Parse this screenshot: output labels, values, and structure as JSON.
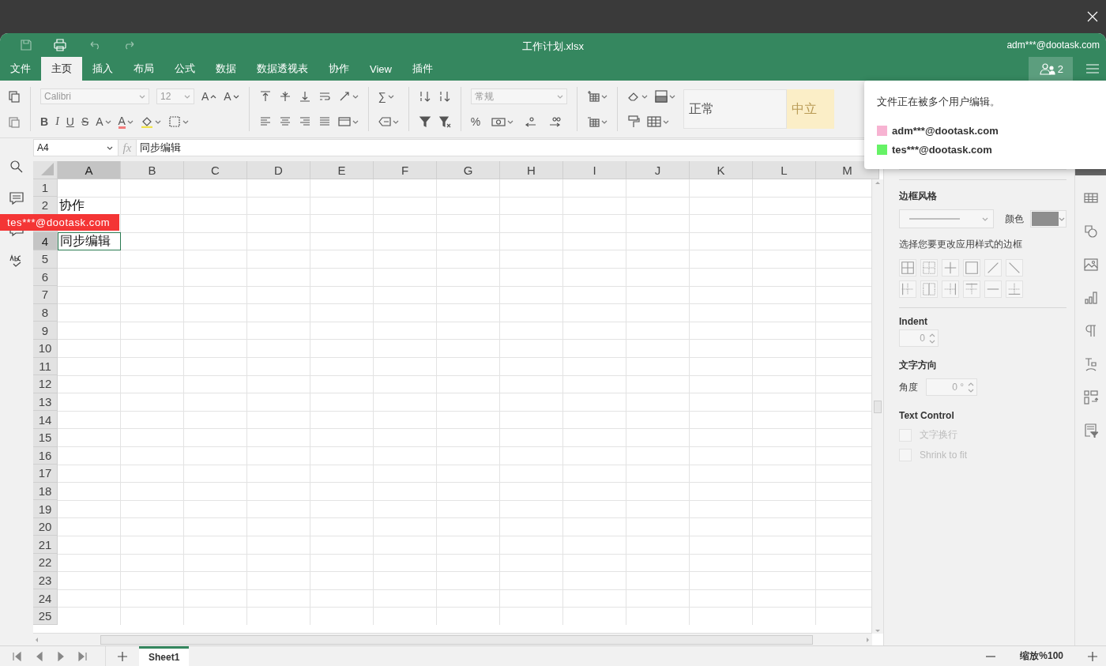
{
  "window": {
    "title": "工作计划.xlsx",
    "user": "adm***@dootask.com"
  },
  "menu_tabs": [
    {
      "label": "文件",
      "selected": false
    },
    {
      "label": "主页",
      "selected": true
    },
    {
      "label": "插入",
      "selected": false
    },
    {
      "label": "布局",
      "selected": false
    },
    {
      "label": "公式",
      "selected": false
    },
    {
      "label": "数据",
      "selected": false
    },
    {
      "label": "数据透视表",
      "selected": false
    },
    {
      "label": "协作",
      "selected": false
    },
    {
      "label": "View",
      "selected": false
    },
    {
      "label": "插件",
      "selected": false
    }
  ],
  "users_button": {
    "count": "2"
  },
  "toolbar": {
    "font_name": "Calibri",
    "font_size": "12",
    "number_format": "常规",
    "glyphs": {
      "grow": "A",
      "shrink": "A",
      "bold": "B",
      "italic": "I",
      "underline": "U",
      "strikethrough": "S",
      "subscript": "A",
      "font_color": "A",
      "sum": "∑",
      "percent": "%"
    },
    "styles": [
      {
        "label": "正常",
        "kind": "normal"
      },
      {
        "label": "中立",
        "kind": "neutral"
      }
    ]
  },
  "formula_bar": {
    "cell_ref": "A4",
    "function_label": "fx",
    "value": "同步编辑"
  },
  "grid": {
    "columns": [
      {
        "label": "A",
        "selected": true
      },
      {
        "label": "B",
        "selected": false
      },
      {
        "label": "C",
        "selected": false
      },
      {
        "label": "D",
        "selected": false
      },
      {
        "label": "E",
        "selected": false
      },
      {
        "label": "F",
        "selected": false
      },
      {
        "label": "G",
        "selected": false
      },
      {
        "label": "H",
        "selected": false
      },
      {
        "label": "I",
        "selected": false
      },
      {
        "label": "J",
        "selected": false
      },
      {
        "label": "K",
        "selected": false
      },
      {
        "label": "L",
        "selected": false
      },
      {
        "label": "M",
        "selected": false
      }
    ],
    "rows": [
      {
        "label": "1",
        "selected": false
      },
      {
        "label": "2",
        "selected": false,
        "cells": [
          "协作"
        ]
      },
      {
        "selected": false
      },
      {
        "label": "4",
        "selected": true,
        "cells": [
          "同步编辑"
        ]
      },
      {
        "label": "5",
        "selected": false
      },
      {
        "label": "6",
        "selected": false
      },
      {
        "label": "7",
        "selected": false
      },
      {
        "label": "8",
        "selected": false
      },
      {
        "label": "9",
        "selected": false
      },
      {
        "label": "10",
        "selected": false
      },
      {
        "label": "11",
        "selected": false
      },
      {
        "label": "12",
        "selected": false
      },
      {
        "label": "13",
        "selected": false
      },
      {
        "label": "14",
        "selected": false
      },
      {
        "label": "15",
        "selected": false
      },
      {
        "label": "16",
        "selected": false
      },
      {
        "label": "17",
        "selected": false
      },
      {
        "label": "18",
        "selected": false
      },
      {
        "label": "19",
        "selected": false
      },
      {
        "label": "20",
        "selected": false
      },
      {
        "label": "21",
        "selected": false
      },
      {
        "label": "22",
        "selected": false
      },
      {
        "label": "23",
        "selected": false
      },
      {
        "label": "24",
        "selected": false
      },
      {
        "label": "25",
        "selected": false
      }
    ]
  },
  "collaborator_cursor": {
    "label": "tes***@dootask.com"
  },
  "collaborators_popup": {
    "message": "文件正在被多个用户编辑。",
    "users": [
      {
        "name": "adm***@dootask.com",
        "color": "#f7b3d2"
      },
      {
        "name": "tes***@dootask.com",
        "color": "#66f266"
      }
    ]
  },
  "format_panel": {
    "border_style_title": "边框风格",
    "color_label": "颜色",
    "border_hint": "选择您要更改应用样式的边框",
    "indent_label": "Indent",
    "indent_value": "0",
    "direction_title": "文字方向",
    "angle_label": "角度",
    "angle_value": "0 °",
    "text_control_title": "Text Control",
    "options": [
      {
        "label": "文字换行",
        "checked": false,
        "disabled": true
      },
      {
        "label": "Shrink to fit",
        "checked": false,
        "disabled": true
      }
    ]
  },
  "sheets": [
    {
      "label": "Sheet1",
      "selected": true
    }
  ],
  "zoom": "缩放%100"
}
